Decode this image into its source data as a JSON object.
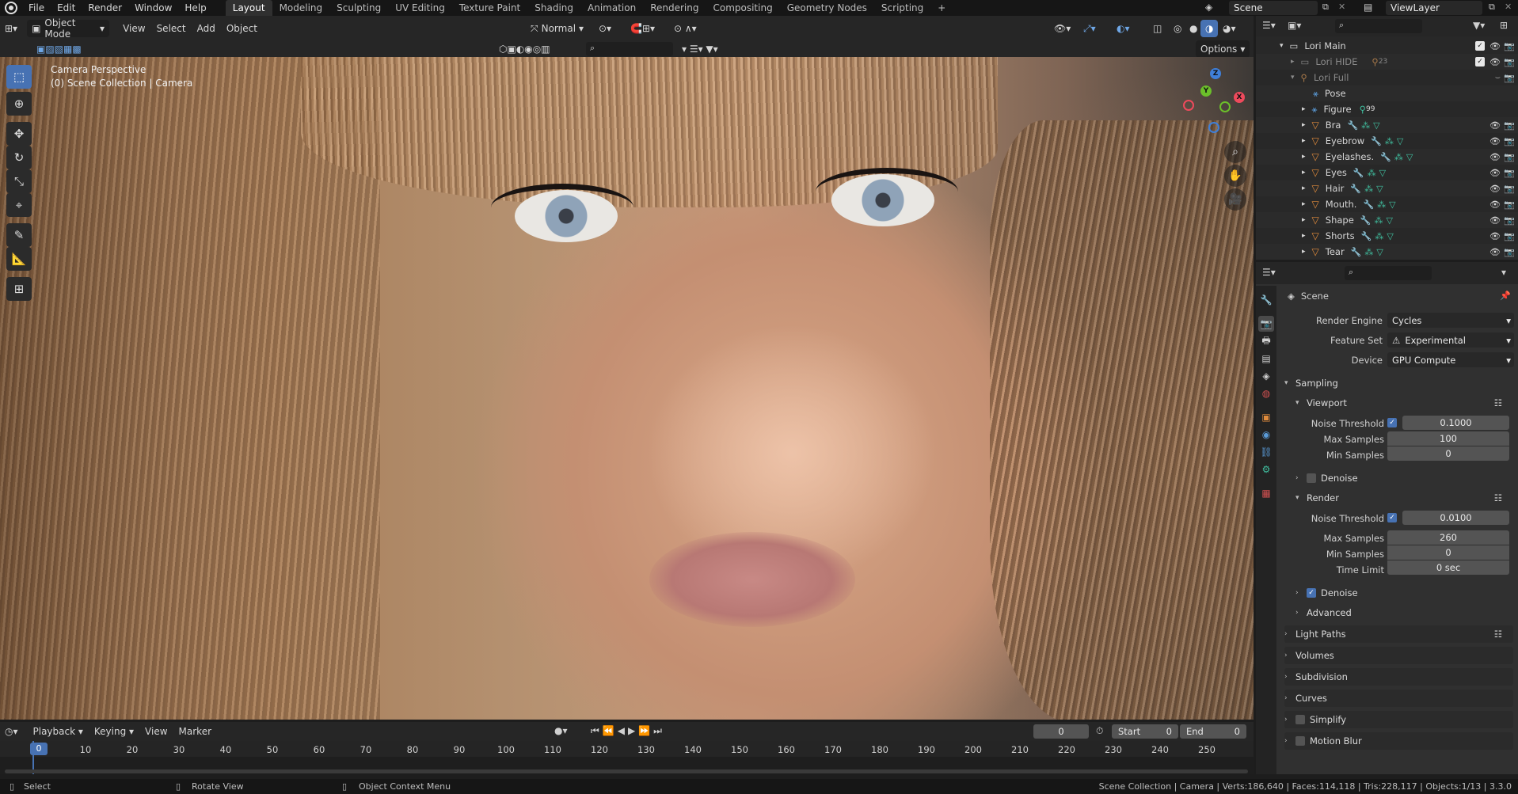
{
  "topbar": {
    "menus": [
      "File",
      "Edit",
      "Render",
      "Window",
      "Help"
    ],
    "workspaces": [
      "Layout",
      "Modeling",
      "Sculpting",
      "UV Editing",
      "Texture Paint",
      "Shading",
      "Animation",
      "Rendering",
      "Compositing",
      "Geometry Nodes",
      "Scripting"
    ],
    "active_workspace": "Layout",
    "scene": "Scene",
    "view_layer": "ViewLayer"
  },
  "viewport_header": {
    "mode": "Object Mode",
    "menus": [
      "View",
      "Select",
      "Add",
      "Object"
    ],
    "orientation": "Normal",
    "options": "Options"
  },
  "viewport": {
    "overlay_line1": "Camera Perspective",
    "overlay_line2": "(0) Scene Collection | Camera"
  },
  "gizmo": {
    "z": "Z",
    "y": "Y",
    "x": "X"
  },
  "outliner": {
    "rows": [
      {
        "label": "Lori Main",
        "badge": ""
      },
      {
        "label": "Lori HIDE",
        "badge": "23"
      },
      {
        "label": "Lori Full",
        "badge": ""
      },
      {
        "label": "Pose",
        "badge": ""
      },
      {
        "label": "Figure",
        "badge": "99"
      },
      {
        "label": "Bra",
        "badge": ""
      },
      {
        "label": "Eyebrow",
        "badge": ""
      },
      {
        "label": "Eyelashes.",
        "badge": ""
      },
      {
        "label": "Eyes",
        "badge": ""
      },
      {
        "label": "Hair",
        "badge": ""
      },
      {
        "label": "Mouth.",
        "badge": ""
      },
      {
        "label": "Shape",
        "badge": ""
      },
      {
        "label": "Shorts",
        "badge": ""
      },
      {
        "label": "Tear",
        "badge": ""
      }
    ]
  },
  "properties": {
    "context": "Scene",
    "render_engine_label": "Render Engine",
    "render_engine": "Cycles",
    "feature_set_label": "Feature Set",
    "feature_set": "Experimental",
    "device_label": "Device",
    "device": "GPU Compute",
    "sampling": "Sampling",
    "viewport": "Viewport",
    "vp_noise_label": "Noise Threshold",
    "vp_noise": "0.1000",
    "vp_max_label": "Max Samples",
    "vp_max": "100",
    "vp_min_label": "Min Samples",
    "vp_min": "0",
    "vp_denoise": "Denoise",
    "render": "Render",
    "r_noise_label": "Noise Threshold",
    "r_noise": "0.0100",
    "r_max_label": "Max Samples",
    "r_max": "260",
    "r_min_label": "Min Samples",
    "r_min": "0",
    "r_time_label": "Time Limit",
    "r_time": "0 sec",
    "r_denoise": "Denoise",
    "advanced": "Advanced",
    "light_paths": "Light Paths",
    "volumes": "Volumes",
    "subdivision": "Subdivision",
    "curves": "Curves",
    "simplify": "Simplify",
    "motion_blur": "Motion Blur"
  },
  "timeline": {
    "menus": [
      "Playback",
      "Keying",
      "View",
      "Marker"
    ],
    "current_frame": "0",
    "start_label": "Start",
    "start": "0",
    "end_label": "End",
    "end": "0",
    "playhead": "0",
    "ticks": [
      "10",
      "20",
      "30",
      "40",
      "50",
      "60",
      "70",
      "80",
      "90",
      "100",
      "110",
      "120",
      "130",
      "140",
      "150",
      "160",
      "170",
      "180",
      "190",
      "200",
      "210",
      "220",
      "230",
      "240",
      "250"
    ]
  },
  "statusbar": {
    "select": "Select",
    "rotate": "Rotate View",
    "context": "Object Context Menu",
    "stats": "Scene Collection | Camera | Verts:186,640 | Faces:114,118 | Tris:228,117 | Objects:1/13 | 3.3.0"
  },
  "colors": {
    "accent": "#4772b3",
    "object_orange": "#e08b3c",
    "bg": "#303030"
  }
}
